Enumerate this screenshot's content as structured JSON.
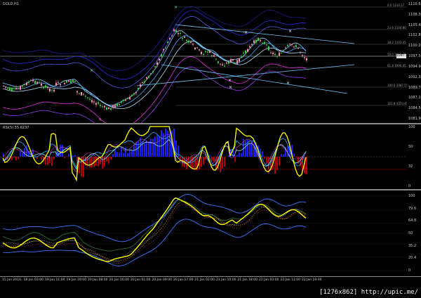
{
  "main": {
    "title": "GOLD,H1",
    "current_price": "1097.18",
    "price_ticks": [
      "1110.65",
      "1108.30",
      "1105.40",
      "1102.80",
      "1100.20",
      "1097.50",
      "1094.90",
      "1092.35",
      "1089.70",
      "1087.10",
      "1084.50",
      "1081.90"
    ],
    "fib_labels": [
      {
        "label": "0.0 1110.17"
      },
      {
        "label": "23.6 1104.80"
      },
      {
        "label": "38.2 1101.45"
      },
      {
        "label": "50.0 1098.75"
      },
      {
        "label": "61.8 1096.05"
      },
      {
        "label": "100.0 1087.55"
      },
      {
        "label": "161.8 1073.45"
      }
    ]
  },
  "rsi": {
    "title": "RSI(5) 55.6237",
    "ticks": [
      "100",
      "50",
      "32",
      "0"
    ]
  },
  "osc": {
    "ticks": [
      "100",
      "79.6",
      "64.8",
      "50",
      "35.2",
      "20.4",
      "0"
    ]
  },
  "time_axis": [
    "15 Jan 2016",
    "18 Jan 03:00",
    "19 Jan 11:00",
    "19 Jan 19:00",
    "20 Jan 08:00",
    "20 Jan 16:00",
    "20 Jan 01:00",
    "20 Jan 09:00",
    "20 Jan 17:00",
    "21 Jan 02:00",
    "21 Jan 10:00",
    "21 Jan 18:00",
    "22 Jan 03:00",
    "22 Jan 11:00",
    "22 Jan 19:00"
  ],
  "watermark": "[1276x862] http://upic.me/",
  "colors": {
    "bull": "#3cd23c",
    "bear": "#ff8cb4",
    "rsi_up": "#1e1eff",
    "rsi_down": "#b40000",
    "yellow": "#ffff00",
    "grid": "#333333"
  }
}
